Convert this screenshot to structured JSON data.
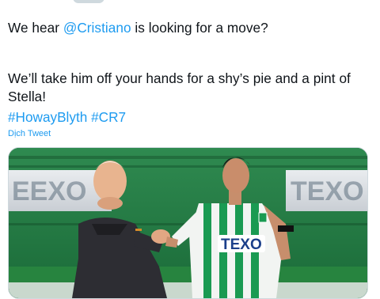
{
  "tweet": {
    "text_line1_before": "We hear ",
    "mention": "@Cristiano",
    "text_line1_after": " is looking for a move?",
    "text_line2": "We’ll take him off your hands for a shy’s pie and a pint of Stella!",
    "hashtag_1": "#HowayBlyth",
    "hashtag_2": "#CR7",
    "translate_link": "Dịch Tweet"
  },
  "media": {
    "board_left_text": "EEXO",
    "board_right_text": "TEXO",
    "shirt_sponsor": "TEXO"
  },
  "colors": {
    "link": "#1d9bf0",
    "text": "#0f1419",
    "pitch_green": "#1b7a3a",
    "kit_green": "#1a9a52"
  }
}
